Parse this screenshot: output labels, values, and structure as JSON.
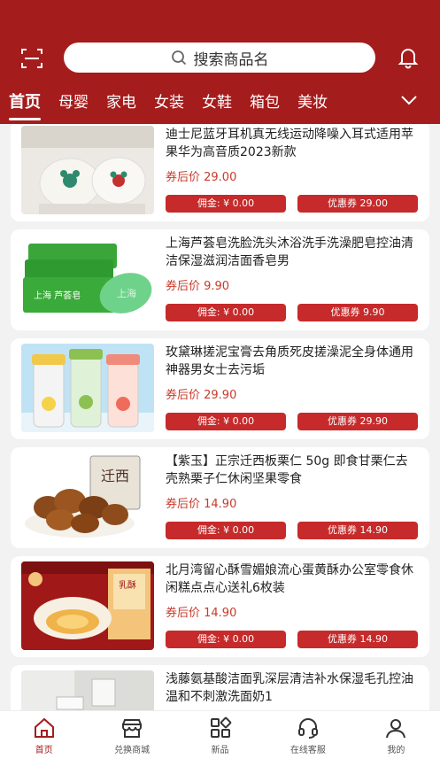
{
  "colors": {
    "brand": "#a51c1c",
    "price": "#c83a2a",
    "pill": "#c62a2a"
  },
  "header": {
    "search_placeholder": "搜索商品名",
    "scan_icon": "scan-icon",
    "bell_icon": "bell-icon"
  },
  "tabs": [
    {
      "label": "首页",
      "active": true
    },
    {
      "label": "母婴"
    },
    {
      "label": "家电"
    },
    {
      "label": "女装"
    },
    {
      "label": "女鞋"
    },
    {
      "label": "箱包"
    },
    {
      "label": "美妆"
    }
  ],
  "products": [
    {
      "title": "迪士尼蓝牙耳机真无线运动降噪入耳式适用苹果华为高音质2023新款",
      "price": "券后价 29.00",
      "commission": "佣金: ¥ 0.00",
      "coupon": "优惠券 29.00"
    },
    {
      "title": "上海芦荟皂洗脸洗头沐浴洗手洗澡肥皂控油清洁保湿滋润洁面香皂男",
      "price": "券后价 9.90",
      "commission": "佣金: ¥ 0.00",
      "coupon": "优惠券 9.90"
    },
    {
      "title": "玫黛琳搓泥宝膏去角质死皮搓澡泥全身体通用神器男女士去污垢",
      "price": "券后价 29.90",
      "commission": "佣金: ¥ 0.00",
      "coupon": "优惠券 29.90"
    },
    {
      "title": "【紫玉】正宗迁西板栗仁 50g 即食甘栗仁去壳熟栗子仁休闲坚果零食",
      "price": "券后价 14.90",
      "commission": "佣金: ¥ 0.00",
      "coupon": "优惠券 14.90"
    },
    {
      "title": "北月湾留心酥雪媚娘流心蛋黄酥办公室零食休闲糕点点心送礼6枚装",
      "price": "券后价 14.90",
      "commission": "佣金: ¥ 0.00",
      "coupon": "优惠券 14.90"
    },
    {
      "title": "浅藤氨基酸洁面乳深层清洁补水保湿毛孔控油温和不刺激洗面奶1",
      "price": "",
      "commission": "",
      "coupon": ""
    }
  ],
  "nav": [
    {
      "label": "首页",
      "icon": "home-icon",
      "active": true
    },
    {
      "label": "兑换商城",
      "icon": "store-icon"
    },
    {
      "label": "新品",
      "icon": "grid-icon"
    },
    {
      "label": "在线客服",
      "icon": "headset-icon"
    },
    {
      "label": "我的",
      "icon": "user-icon"
    }
  ]
}
